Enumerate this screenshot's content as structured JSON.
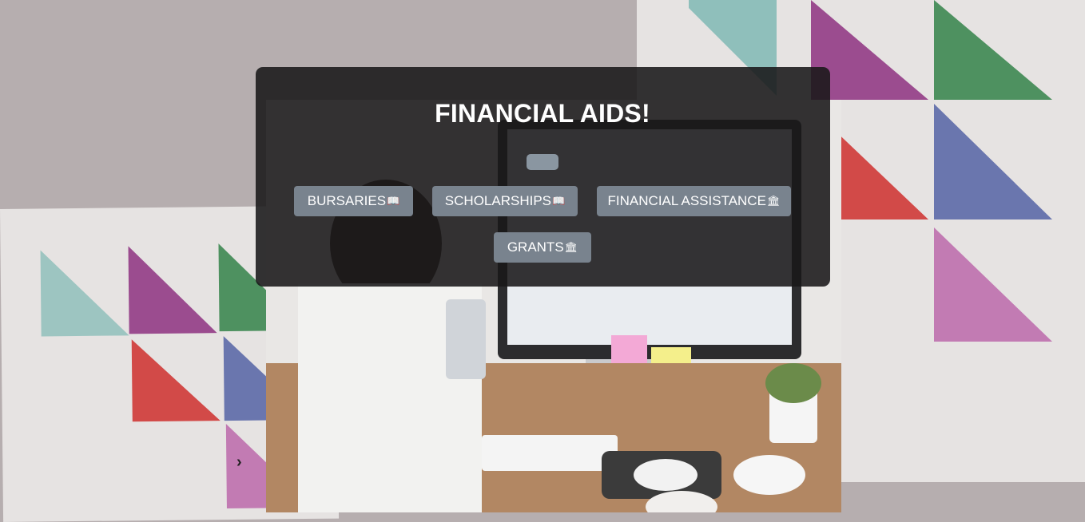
{
  "header": {
    "title": "FINANCIAL AIDS!"
  },
  "buttons": {
    "bursaries": {
      "label": "BURSARIES",
      "icon": "📖",
      "icon_name": "book-icon"
    },
    "scholarships": {
      "label": "SCHOLARSHIPS",
      "icon": "📖",
      "icon_name": "book-icon"
    },
    "financial_assistance": {
      "label": "FINANCIAL ASSISTANCE",
      "icon": "🏛",
      "icon_name": "bank-icon"
    },
    "grants": {
      "label": "GRANTS",
      "icon": "🏛",
      "icon_name": "bank-icon"
    }
  },
  "carousel": {
    "next_icon": "›",
    "next_icon_name": "chevron-right-icon"
  },
  "colors": {
    "overlay": "#191819",
    "button": "#79838e",
    "page_bg": "#b6aeaf",
    "teal": "#8fbfbb",
    "purple": "#9b4c8f",
    "green": "#4e9160",
    "red": "#d24a48",
    "blue": "#6a76ae",
    "pink": "#c27bb3"
  }
}
